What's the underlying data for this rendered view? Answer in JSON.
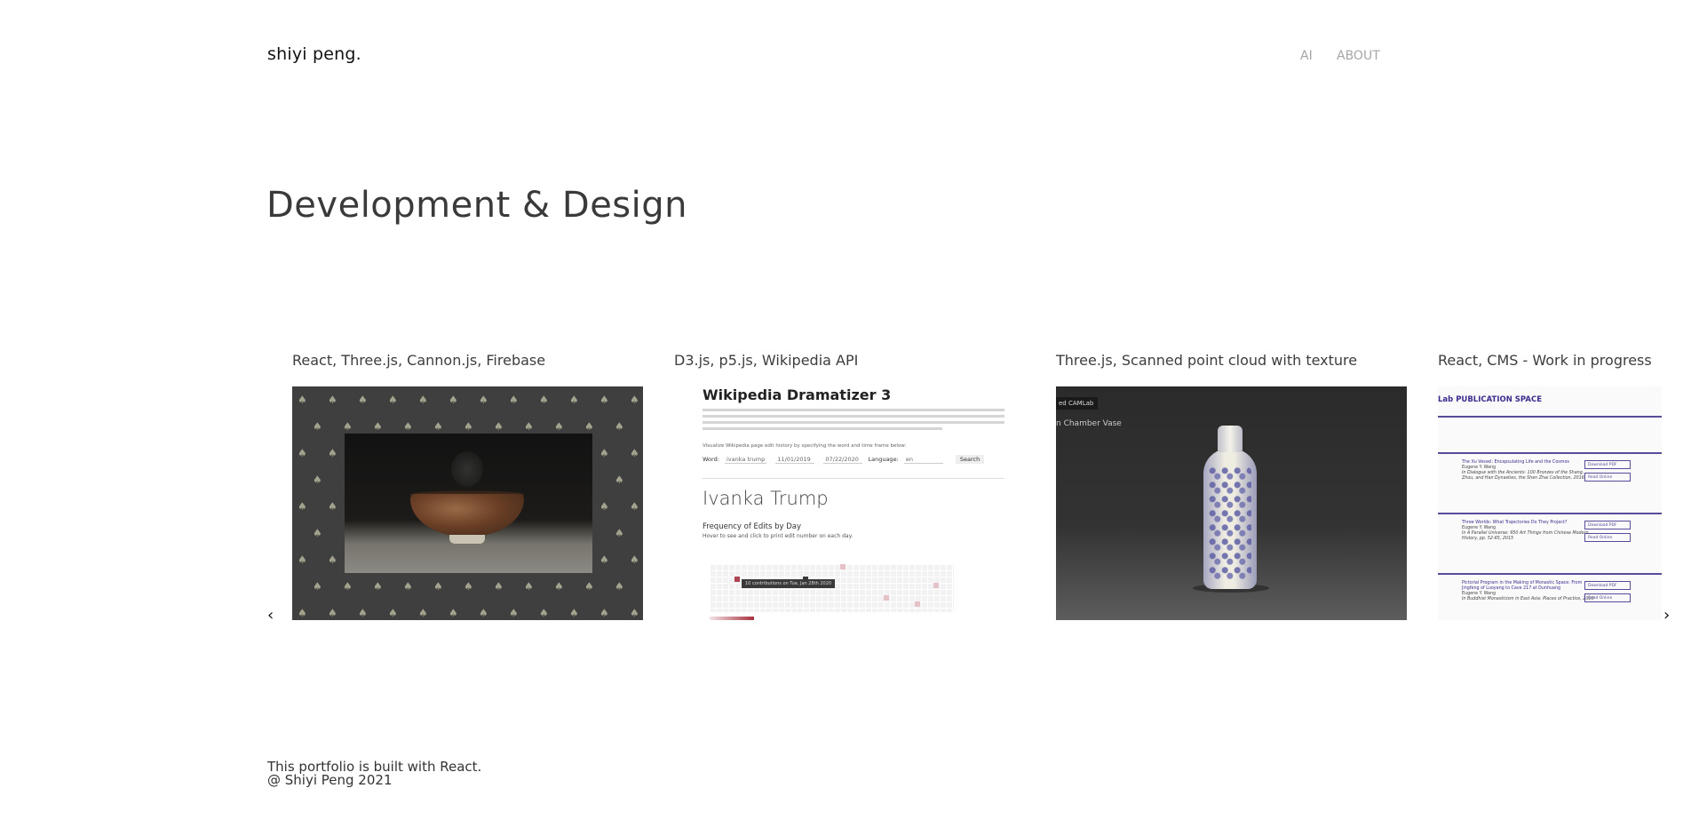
{
  "header": {
    "logo": "shiyi peng.",
    "nav": [
      {
        "label": "AI"
      },
      {
        "label": "ABOUT"
      }
    ]
  },
  "page": {
    "title": "Development & Design"
  },
  "carousel": {
    "prev_glyph": "‹",
    "next_glyph": "›",
    "items": [
      {
        "caption": "React, Three.js, Cannon.js, Firebase"
      },
      {
        "caption": "D3.js, p5.js, Wikipedia API",
        "preview": {
          "title": "Wikipedia Dramatizer 3",
          "instruction": "Visualize Wikipedia page edit history by specifying the word and time frame below:",
          "word_label": "Word:",
          "word_value": "ivanka trump",
          "date_from": "11/01/2019",
          "date_to": "07/22/2020",
          "language_label": "Language:",
          "language_value": "en",
          "search_label": "Search",
          "subject": "Ivanka Trump",
          "freq_title": "Frequency of Edits by Day",
          "freq_hint": "Hover to see and click to print edit number on each day.",
          "tooltip": "10 contributions on Tue, Jan 28th 2020"
        }
      },
      {
        "caption": "Three.js, Scanned point cloud with texture",
        "preview": {
          "tag": "ed CAMLab",
          "object_name": "n Chamber Vase"
        }
      },
      {
        "caption": "React, CMS - Work in progress",
        "preview": {
          "header": "Lab PUBLICATION SPACE",
          "entries": [
            {
              "title": "The Xu Vessel: Encapsulating Life and the Cosmos",
              "author": "Eugene Y. Wang",
              "ref": "In Dialogue with the Ancients: 100 Bronzes of the Shang, Zhou, and Han Dynasties, the Shen Zhai Collection, 2016",
              "btn1": "Download PDF",
              "btn2": "Read Online"
            },
            {
              "title": "Three Worlds: What Trajectories Do They Project?",
              "author": "Eugene Y. Wang",
              "ref": "In A Parallel Universe: 950 Art Things from Chinese Modern History, pp. 52-65, 2015",
              "btn1": "Download PDF",
              "btn2": "Read Online"
            },
            {
              "title": "Pictorial Program in the Making of Monastic Space: From Jingfeng of Luoyang to Cave 217 at Dunhuang",
              "author": "Eugene Y. Wang",
              "ref": "In Buddhist Monasticism in East Asia: Places of Practice, 2010",
              "btn1": "Download PDF",
              "btn2": "Read Online"
            }
          ]
        }
      }
    ]
  },
  "footer": {
    "line1": "This portfolio is built with React.",
    "line2": "@ Shiyi Peng 2021"
  }
}
